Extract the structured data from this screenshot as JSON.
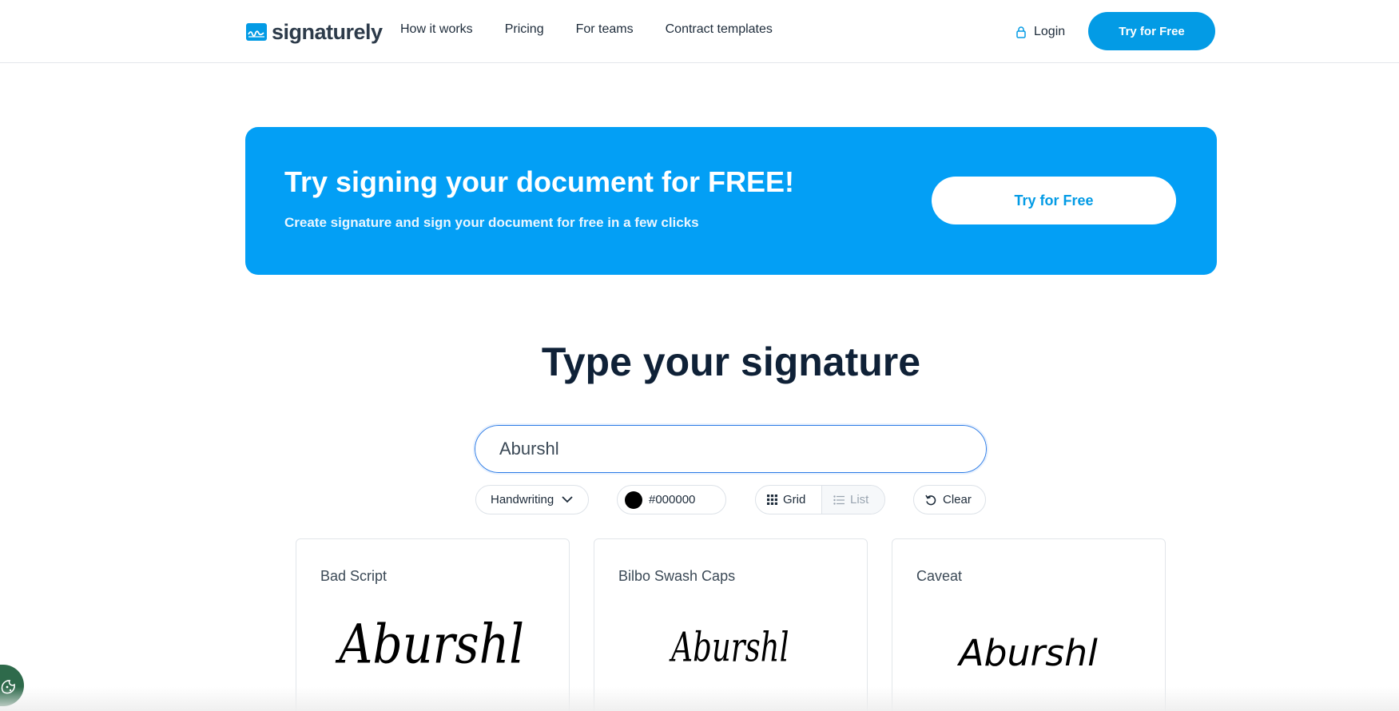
{
  "header": {
    "logo_text": "signaturely",
    "nav": [
      "How it works",
      "Pricing",
      "For teams",
      "Contract templates"
    ],
    "login_label": "Login",
    "cta_label": "Try for Free"
  },
  "banner": {
    "title": "Try signing your document for FREE!",
    "subtitle": "Create signature and sign your document for free in a few clicks",
    "cta_label": "Try for Free"
  },
  "signature": {
    "title": "Type your signature",
    "input_value": "Aburshl",
    "font_select": "Handwriting",
    "color_value": "#000000",
    "view_grid": "Grid",
    "view_list": "List",
    "clear_label": "Clear",
    "cards": [
      {
        "font_name": "Bad Script",
        "preview": "Aburshl"
      },
      {
        "font_name": "Bilbo Swash Caps",
        "preview": "Aburshl"
      },
      {
        "font_name": "Caveat",
        "preview": "Aburshl"
      }
    ]
  },
  "colors": {
    "brand": "#039be5",
    "banner": "#039ff5",
    "text_dark": "#0f2137",
    "cookie": "#2e6a4b"
  }
}
